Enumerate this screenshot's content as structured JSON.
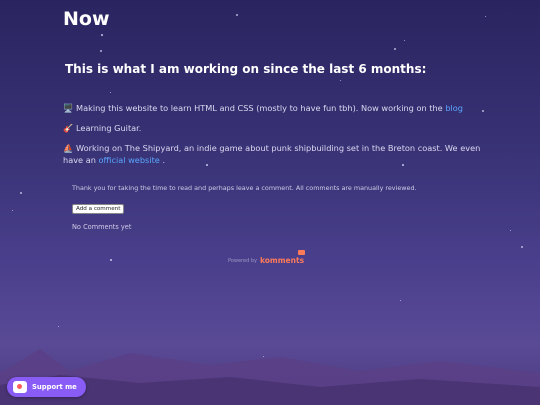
{
  "page": {
    "title": "Now"
  },
  "section": {
    "subtitle": "This is what I am working on since the last 6 months:"
  },
  "items": [
    {
      "emoji": "🖥️",
      "text": "Making this website to learn HTML and CSS (mostly to have fun tbh). Now working on the ",
      "link": "blog",
      "suffix": ""
    },
    {
      "emoji": "🎸",
      "text": "Learning Guitar.",
      "link": "",
      "suffix": ""
    },
    {
      "emoji": "⛵",
      "text": "Working on The Shipyard, an indie game about punk shipbuilding set in the Breton coast. We even have an",
      "link": "official website",
      "suffix": " ."
    }
  ],
  "comments": {
    "intro": "Thank you for taking the time to read and perhaps leave a comment. All comments are manually reviewed.",
    "add_button": "Add a comment",
    "empty_text": "No Comments yet",
    "powered_by": "Powered by",
    "brand": "komments"
  },
  "support": {
    "label": "Support me",
    "icon": "ko-fi-cup-icon"
  },
  "colors": {
    "background_top": "#2a2460",
    "background_bottom": "#5a4a96",
    "link": "#5aa6ff",
    "support_button": "#8a5cf6",
    "brand": "#ff7a59"
  }
}
